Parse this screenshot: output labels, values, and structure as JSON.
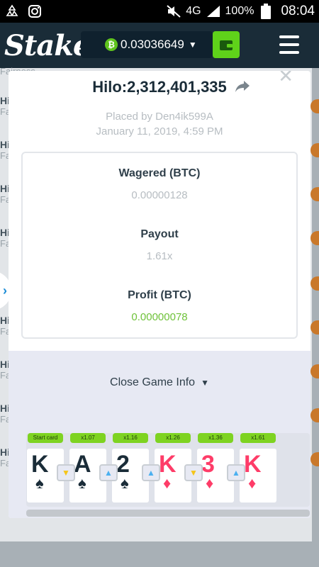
{
  "status_bar": {
    "battery": "100%",
    "time": "08:04",
    "network": "4G"
  },
  "app": {
    "logo": "Stake",
    "balance": "0.03036649",
    "currency_icon": "bitcoin-icon"
  },
  "background": {
    "partial_text": "Fairness",
    "row_heading": "Hi",
    "row_sub": "Fa"
  },
  "modal": {
    "title": "Hilo:2,312,401,335",
    "placed_by": "Placed by Den4ik599A",
    "date": "January 11, 2019, 4:59 PM",
    "stats": [
      {
        "label": "Wagered (BTC)",
        "value": "0.00000128"
      },
      {
        "label": "Payout",
        "value": "1.61x"
      },
      {
        "label": "Profit (BTC)",
        "value": "0.00000078"
      }
    ],
    "close_info_label": "Close Game Info",
    "cards": [
      {
        "mult": "Start card",
        "rank": "K",
        "suit": "♠",
        "color": "black"
      },
      {
        "mult": "x1.07",
        "rank": "A",
        "suit": "♠",
        "color": "black"
      },
      {
        "mult": "x1.16",
        "rank": "2",
        "suit": "♠",
        "color": "black"
      },
      {
        "mult": "x1.26",
        "rank": "K",
        "suit": "♦",
        "color": "red"
      },
      {
        "mult": "x1.36",
        "rank": "3",
        "suit": "♦",
        "color": "red"
      },
      {
        "mult": "x1.61",
        "rank": "K",
        "suit": "♦",
        "color": "red"
      }
    ],
    "guesses": [
      "down",
      "up",
      "up",
      "down",
      "up"
    ]
  }
}
